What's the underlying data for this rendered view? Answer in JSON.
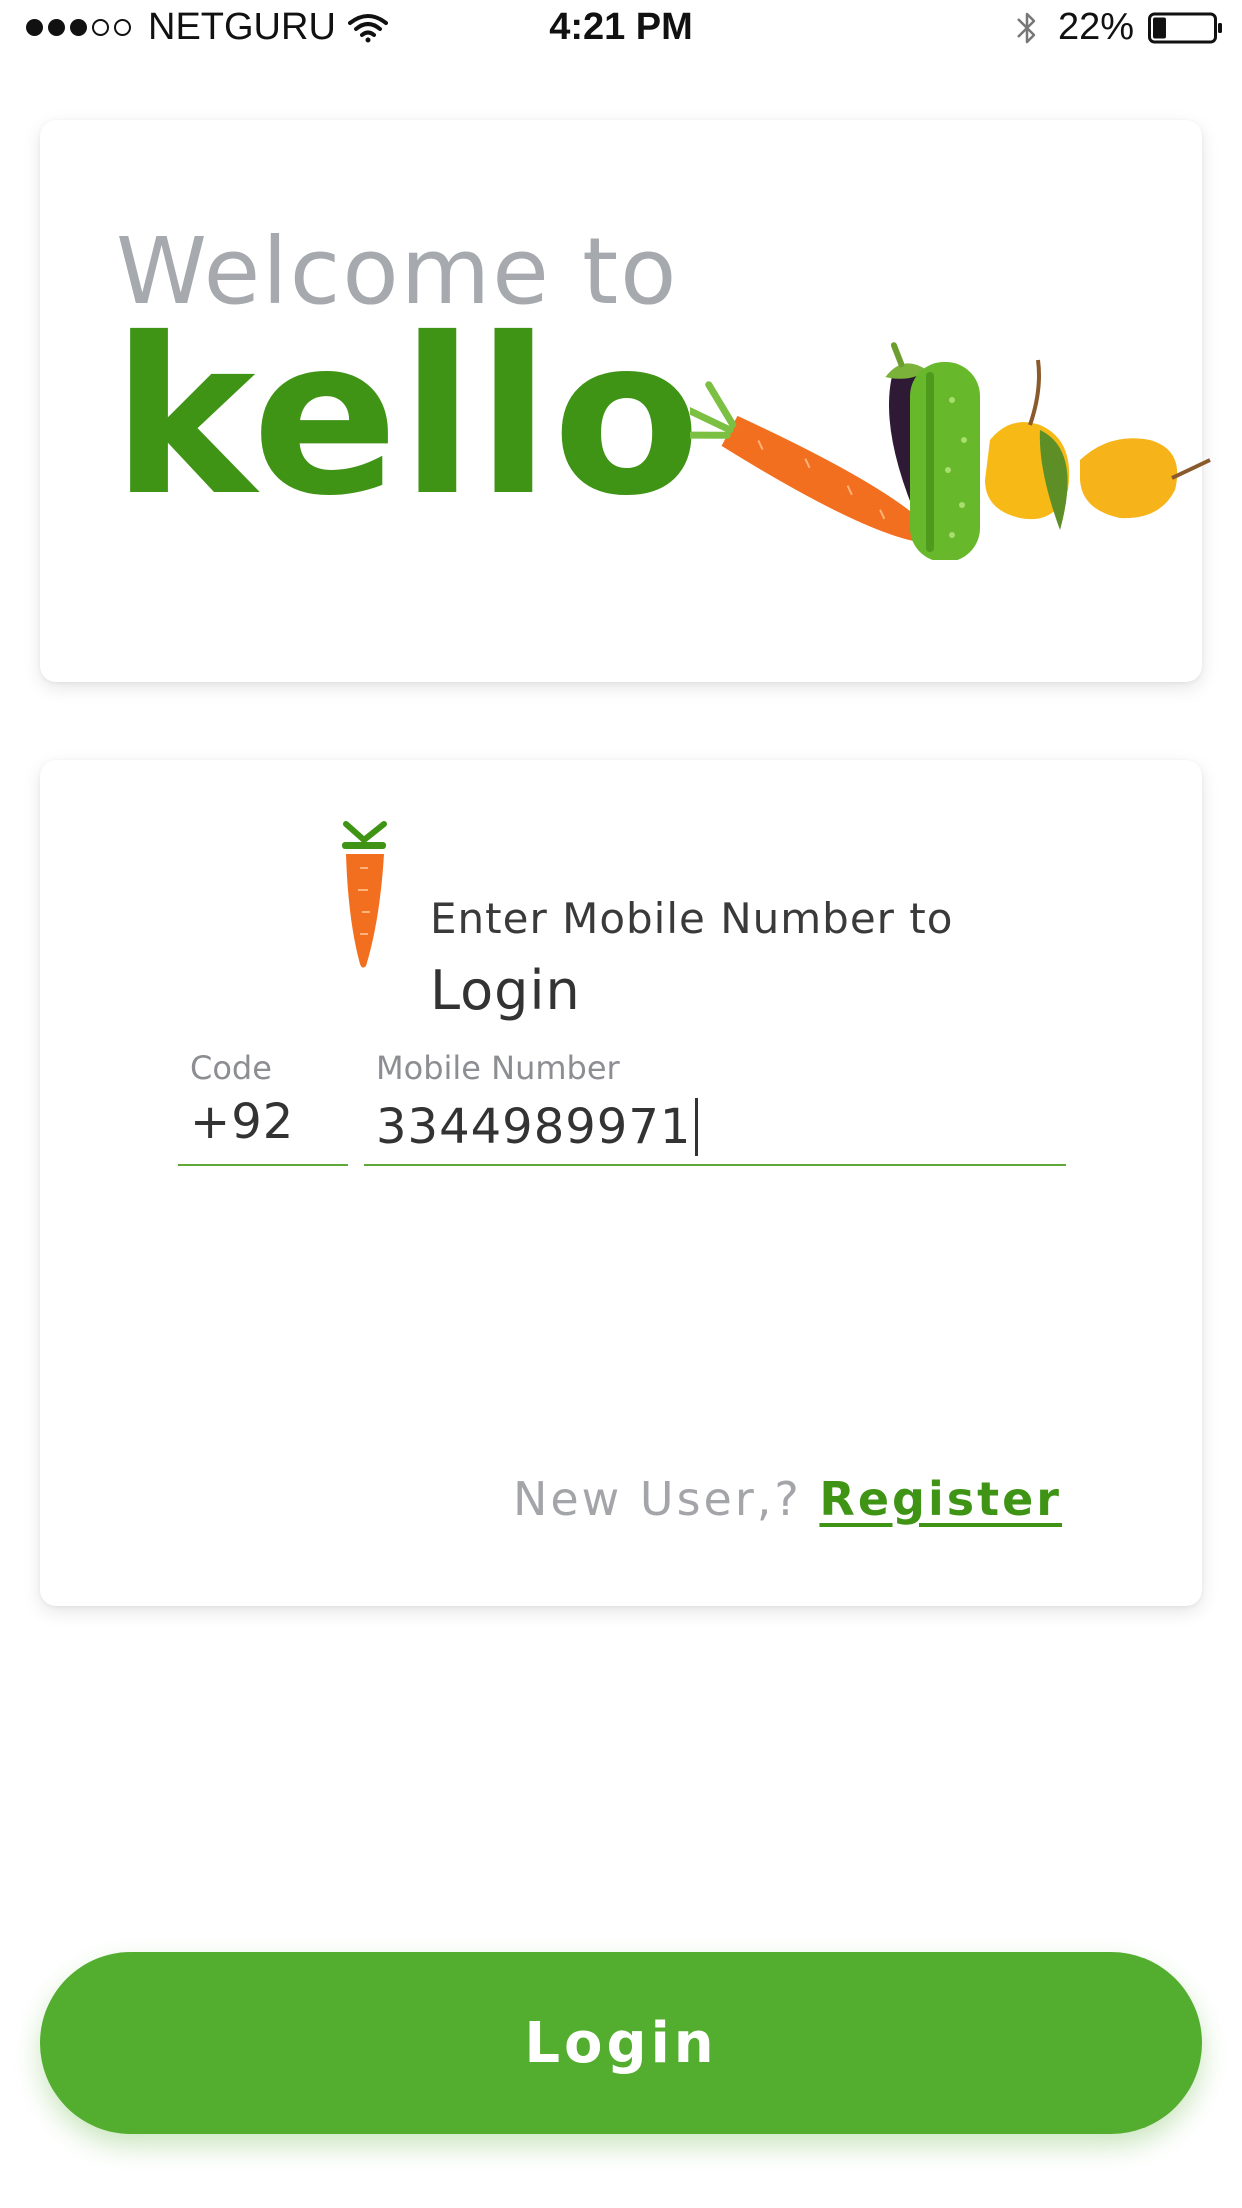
{
  "status_bar": {
    "carrier": "NETGURU",
    "time": "4:21 PM",
    "battery": "22%",
    "battery_level": 0.22
  },
  "welcome": {
    "line1": "Welcome to",
    "brand": "kello",
    "illustration": "vegetables-illustration"
  },
  "login_form": {
    "prompt_line1": "Enter Mobile Number to",
    "prompt_line2": "Login",
    "code_label": "Code",
    "code_value": "+92",
    "mobile_label": "Mobile Number",
    "mobile_value": "3344989971",
    "new_user_text": "New User,?",
    "register_link": "Register"
  },
  "login_button": {
    "label": "Login"
  },
  "colors": {
    "brand_green": "#3f9416",
    "button_green": "#53ad2f",
    "welcome_gray": "#a6a9ae"
  }
}
